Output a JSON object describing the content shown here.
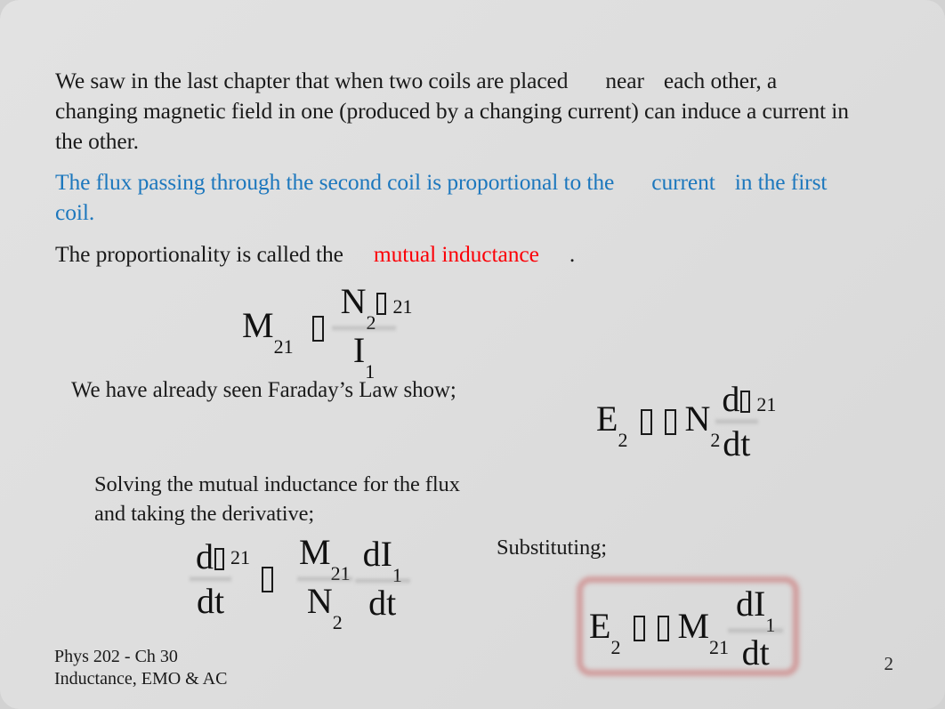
{
  "slide": {
    "page_number": "2",
    "background_color": "#dedede",
    "accent_blue": "#1c77bd",
    "accent_red": "#fb0007",
    "highlight_box_color": "#c55050"
  },
  "body": {
    "intro": {
      "part1": "We saw in the last chapter that when two coils are placed",
      "part2": "near",
      "part3": "each other, a changing magnetic field in one (produced by a changing current) can induce a current in the other."
    },
    "flux_statement": {
      "part1": "The  flux  passing through the second coil is proportional to the",
      "part2": "current",
      "part3": "in the first coil."
    },
    "proportionality": {
      "part1": "The proportionality is called the",
      "emphasis": "mutual inductance",
      "part2": "."
    },
    "faraday_note": "We have already seen Faraday’s Law show;",
    "solving_note": "Solving the mutual inductance for the flux and taking the derivative;",
    "substituting_note": "Substituting;"
  },
  "equations": {
    "mutual_inductance": {
      "lhs_var": "M",
      "lhs_sub": "21",
      "equals_glyph": "□",
      "num_var": "N",
      "num_sub": "2",
      "flux_glyph": "□",
      "flux_sub": "21",
      "den_var": "I",
      "den_sub": "1"
    },
    "faraday_emf": {
      "lhs_var": "E",
      "lhs_sub": "2",
      "equals_glyph": "□",
      "minus_glyph": "□",
      "coeff_var": "N",
      "coeff_sub": "2",
      "num_d": "d",
      "num_flux_glyph": "□",
      "num_sub": "21",
      "den": "dt"
    },
    "flux_derivative": {
      "num_d": "d",
      "num_flux_glyph": "□",
      "num_sub": "21",
      "den": "dt",
      "equals_glyph": "□",
      "rhs_num_var": "M",
      "rhs_num_sub": "21",
      "rhs_den_var": "N",
      "rhs_den_sub": "2",
      "rhs2_num_d": "dI",
      "rhs2_num_sub": "1",
      "rhs2_den": "dt"
    },
    "result_boxed": {
      "lhs_var": "E",
      "lhs_sub": "2",
      "equals_glyph": "□",
      "minus_glyph": "□",
      "coeff_var": "M",
      "coeff_sub": "21",
      "num_d": "dI",
      "num_sub": "1",
      "den": "dt"
    }
  },
  "footer": {
    "line1": "Phys 202 - Ch 30",
    "line2": "Inductance, EMO & AC"
  }
}
